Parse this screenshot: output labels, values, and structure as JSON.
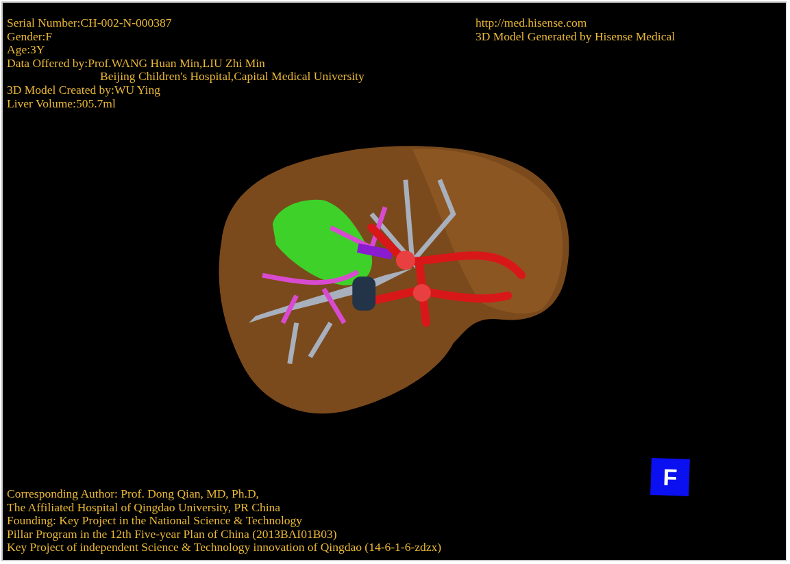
{
  "info_left": [
    {
      "kind": "line",
      "text": "Serial Number:CH-002-N-000387"
    },
    {
      "kind": "line",
      "text": "Gender:F"
    },
    {
      "kind": "line",
      "text": "Age:3Y"
    },
    {
      "kind": "line",
      "text": "Data Offered by:Prof.WANG Huan Min,LIU Zhi Min"
    },
    {
      "kind": "continuation",
      "text": "Beijing Children's Hospital,Capital Medical University"
    },
    {
      "kind": "line",
      "text": "3D Model Created by:WU Ying"
    },
    {
      "kind": "line",
      "text": "Liver Volume:505.7ml"
    }
  ],
  "info_right": [
    "http://med.hisense.com",
    "3D Model Generated by Hisense Medical"
  ],
  "credits": [
    "Corresponding Author: Prof. Dong Qian, MD, Ph.D,",
    "The Affiliated Hospital of Qingdao University, PR China",
    "Founding: Key Project in the National Science & Technology",
    "Pillar Program in the 12th Five-year Plan of China (2013BAI01B03)",
    "Key Project of independent Science & Technology innovation of Qingdao (14-6-1-6-zdzx)"
  ],
  "orientation_marker": {
    "label": "F"
  }
}
